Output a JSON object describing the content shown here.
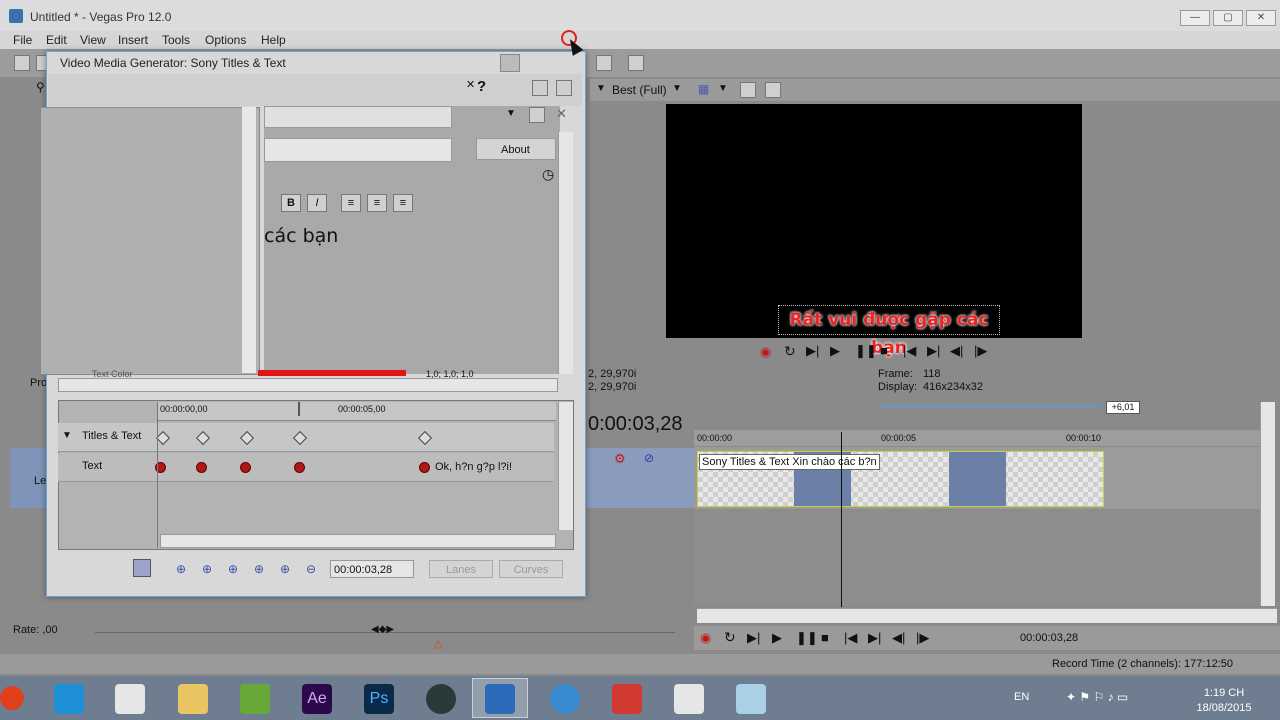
{
  "window": {
    "title": "Untitled * - Vegas Pro 12.0",
    "min": "—",
    "max": "▢",
    "close": "✕"
  },
  "menu": [
    "File",
    "Edit",
    "View",
    "Insert",
    "Tools",
    "Options",
    "Help"
  ],
  "preview": {
    "quality": "Best (Full)",
    "overlay_text": "Rất vui được gặp các bạn",
    "project_fps_1": "2, 29,970i",
    "project_fps_2": "2, 29,970i",
    "frame_label": "Frame:",
    "frame_value": "118",
    "display_label": "Display:",
    "display_value": "416x234x32",
    "badge": "+6,01"
  },
  "timeline": {
    "current_time": "0:00:03,28",
    "ruler": [
      "00:00:00",
      "00:00:05",
      "00:00:10"
    ],
    "clip_label": "Sony Titles & Text Xin chào các b?n",
    "track_label": "Le",
    "bottom_time": "00:00:03,28",
    "record_time": "Record Time (2 channels): 177:12:50",
    "rate": "Rate: ,00",
    "pro_label": "Pro"
  },
  "dialog": {
    "title_prefix": "Video Media Generator:",
    "title_name": "Sony Titles & Text",
    "about": "About",
    "bold": "B",
    "italic": "I",
    "text_preview": "các bạn",
    "text_color_label": "Text Color",
    "size_label": "1,0; 1,0; 1,0",
    "kf_ruler_start": "00:00:00,00",
    "kf_ruler_mid": "00:00:05,00",
    "rows": [
      {
        "label": "Titles & Text"
      },
      {
        "label": "Text",
        "note": "Ok, h?n g?p l?i!"
      }
    ],
    "time_field": "00:00:03,28",
    "lanes": "Lanes",
    "curves": "Curves"
  },
  "taskbar": {
    "lang": "EN",
    "time": "1:19 CH",
    "date": "18/08/2015"
  }
}
